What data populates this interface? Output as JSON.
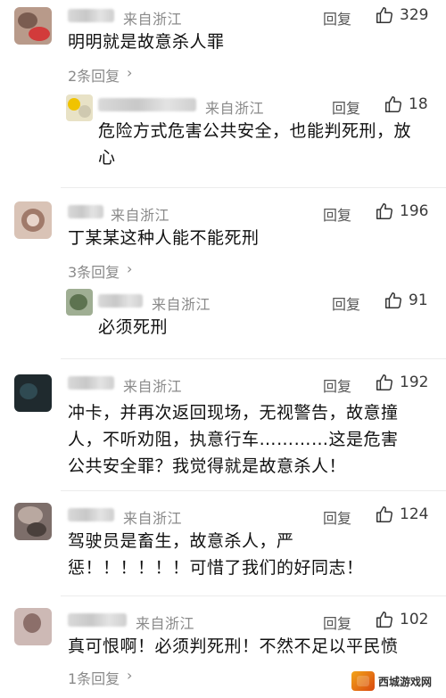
{
  "comments": [
    {
      "source": "来自浙江",
      "reply_label": "回复",
      "likes": "329",
      "content": "明明就是故意杀人罪",
      "replies_link": "2条回复",
      "sub_reply": {
        "source": "来自浙江",
        "reply_label": "回复",
        "likes": "18",
        "content_line1": "危险方式危害公共安全，也能判死刑，放",
        "content_line2": "心"
      }
    },
    {
      "source": "来自浙江",
      "reply_label": "回复",
      "likes": "196",
      "content": "丁某某这种人能不能死刑",
      "replies_link": "3条回复",
      "sub_reply": {
        "source": "来自浙江",
        "reply_label": "回复",
        "likes": "91",
        "content_line1": "必须死刑"
      }
    },
    {
      "source": "来自浙江",
      "reply_label": "回复",
      "likes": "192",
      "content_line1": "冲卡，并再次返回现场，无视警告，故意撞",
      "content_line2": "人，不听劝阻，执意行车…………这是危害",
      "content_line3": "公共安全罪？我觉得就是故意杀人！"
    },
    {
      "source": "来自浙江",
      "reply_label": "回复",
      "likes": "124",
      "content_line1": "驾驶员是畜生，故意杀人，严",
      "content_line2": "惩！！！！！！可惜了我们的好同志！"
    },
    {
      "source": "来自浙江",
      "reply_label": "回复",
      "likes": "102",
      "content": "真可恨啊！必须判死刑！不然不足以平民愤",
      "replies_link": "1条回复"
    }
  ],
  "watermark": {
    "text": "西城游戏网"
  },
  "colors": {
    "text": "#111111",
    "meta": "#8a8a8a",
    "icon": "#333333"
  }
}
